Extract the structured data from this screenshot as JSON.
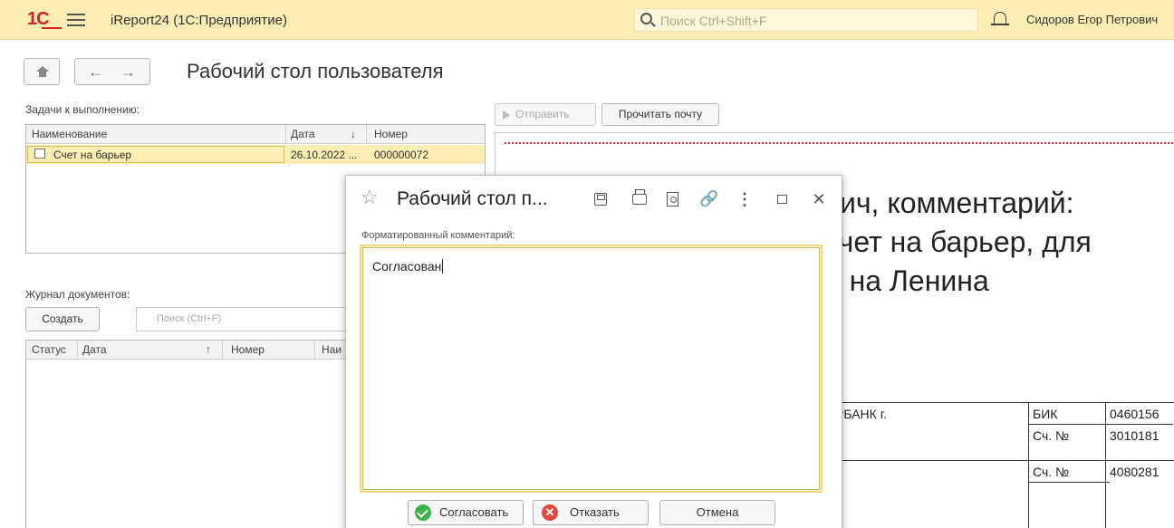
{
  "topbar": {
    "logo": "1С",
    "app_title": "iReport24  (1С:Предприятие)",
    "search_placeholder": "Поиск Ctrl+Shift+F",
    "user_name": "Сидоров Егор Петрович"
  },
  "page": {
    "title": "Рабочий стол пользователя"
  },
  "tasks": {
    "label": "Задачи к выполнению:",
    "columns": [
      "Наименование",
      "Дата",
      "Номер"
    ],
    "sort_indicator": "↓",
    "rows": [
      {
        "name": "Счет на барьер",
        "date": "26.10.2022 ...",
        "number": "000000072"
      }
    ]
  },
  "journal": {
    "label": "Журнал документов:",
    "create_label": "Создать",
    "search_placeholder": "Поиск (Ctrl+F)",
    "columns": [
      "Статус",
      "Дата",
      "Номер",
      "Наи"
    ],
    "sort_indicator": "↑"
  },
  "mail": {
    "send_label": "Отправить",
    "read_label": "Прочитать почту"
  },
  "document": {
    "lines": [
      "вич, комментарий:",
      "счет на барьер, для",
      "л на Ленина"
    ],
    "bank_fragment": "РБАНК г.",
    "bik_label": "БИК",
    "bik_value": "0460156",
    "acc1_label": "Сч. №",
    "acc1_value": "3010181",
    "acc2_label": "Сч. №",
    "acc2_value": "4080281"
  },
  "dialog": {
    "title": "Рабочий стол п...",
    "field_label": "Форматированный комментарий:",
    "comment_value": "Согласован",
    "approve_label": "Согласовать",
    "reject_label": "Отказать",
    "cancel_label": "Отмена"
  },
  "colors": {
    "topbar_bg": "#fbedb4",
    "selection_bg": "#fbedb4",
    "brand_red": "#d2232a",
    "approve_green": "#3bb24a",
    "reject_red": "#e2493a"
  }
}
